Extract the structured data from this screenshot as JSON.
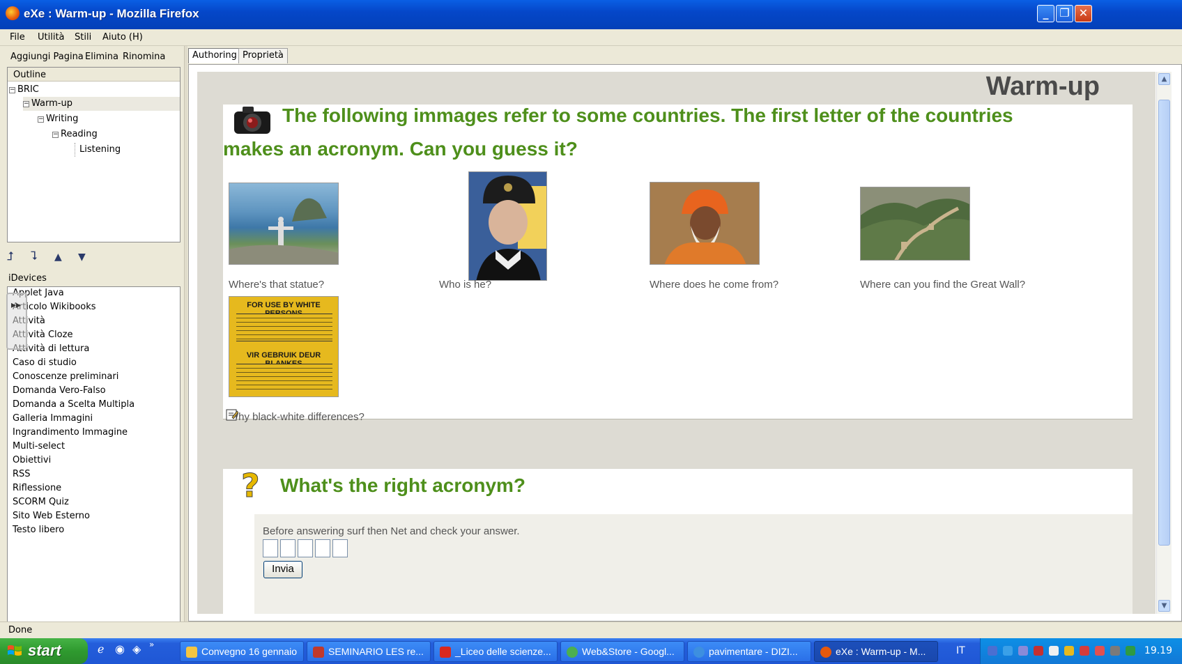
{
  "window": {
    "title": "eXe : Warm-up - Mozilla Firefox",
    "controls": {
      "minimize": "_",
      "maximize": "❐",
      "close": "✕"
    }
  },
  "menu": [
    "File",
    "Utilità",
    "Stili",
    "Aiuto (H)"
  ],
  "left_toolbar": [
    "Aggiungi Pagina",
    "Elimina",
    "Rinomina"
  ],
  "outline": {
    "header": "Outline",
    "items": [
      {
        "label": "BRIC",
        "toggle": "−",
        "level": 0
      },
      {
        "label": "Warm-up",
        "toggle": "−",
        "level": 1,
        "selected": true
      },
      {
        "label": "Writing",
        "toggle": "−",
        "level": 2
      },
      {
        "label": "Reading",
        "toggle": "−",
        "level": 3
      },
      {
        "label": "Listening",
        "toggle": "",
        "level": 4
      }
    ]
  },
  "outline_arrows": [
    "⮥",
    "⮧",
    "▲",
    "▼"
  ],
  "idevices": {
    "header": "iDevices",
    "items": [
      "Applet Java",
      "Articolo Wikibooks",
      "Attività",
      "Attività Cloze",
      "Attività di lettura",
      "Caso di studio",
      "Conoscenze preliminari",
      "Domanda Vero-Falso",
      "Domanda a Scelta Multipla",
      "Galleria Immagini",
      "Ingrandimento Immagine",
      "Multi-select",
      "Obiettivi",
      "RSS",
      "Riflessione",
      "SCORM Quiz",
      "Sito Web Esterno",
      "Testo libero"
    ]
  },
  "tabs": [
    {
      "label": "Authoring",
      "active": true
    },
    {
      "label": "Proprietà",
      "active": false
    }
  ],
  "page": {
    "title": "Warm-up",
    "idevice1": {
      "heading_line1": "The following immages refer to some countries. The first letter of the countries",
      "heading_line2": "makes an acronym. Can you guess it?",
      "images": [
        {
          "caption": "Where's that statue?",
          "subject": "Christ the Redeemer, Rio"
        },
        {
          "caption": "Who is he?",
          "subject": "man in fur hat"
        },
        {
          "caption": "Where does he come from?",
          "subject": "bearded man with orange turban"
        },
        {
          "caption": "Where can you find the Great Wall?",
          "subject": "Great Wall"
        },
        {
          "caption": "Why black-white differences?",
          "subject": "apartheid sign",
          "sign_line1": "FOR USE BY WHITE PERSONS",
          "sign_line2": "VIR GEBRUIK DEUR BLANKES"
        }
      ]
    },
    "idevice2": {
      "heading": "What's the right acronym?",
      "instruction": "Before answering surf then Net and check your answer.",
      "input_count": 5,
      "submit_label": "Invia"
    }
  },
  "status": "Done",
  "taskbar": {
    "start_label": "start",
    "tasks": [
      {
        "label": "Convegno 16 gennaio",
        "color": "#f4c542"
      },
      {
        "label": "SEMINARIO LES re...",
        "color": "#c0392b"
      },
      {
        "label": "_Liceo delle scienze...",
        "color": "#d9281e"
      },
      {
        "label": "Web&Store - Googl...",
        "color": "#4caf50"
      },
      {
        "label": "pavimentare - DIZI...",
        "color": "#3d8fe0"
      },
      {
        "label": "eXe : Warm-up - M...",
        "color": "#e8590c",
        "active": true
      }
    ],
    "language": "IT",
    "clock": "19.19"
  },
  "colors": {
    "heading_green": "#4e8f1b",
    "xp_blue": "#245edb"
  }
}
